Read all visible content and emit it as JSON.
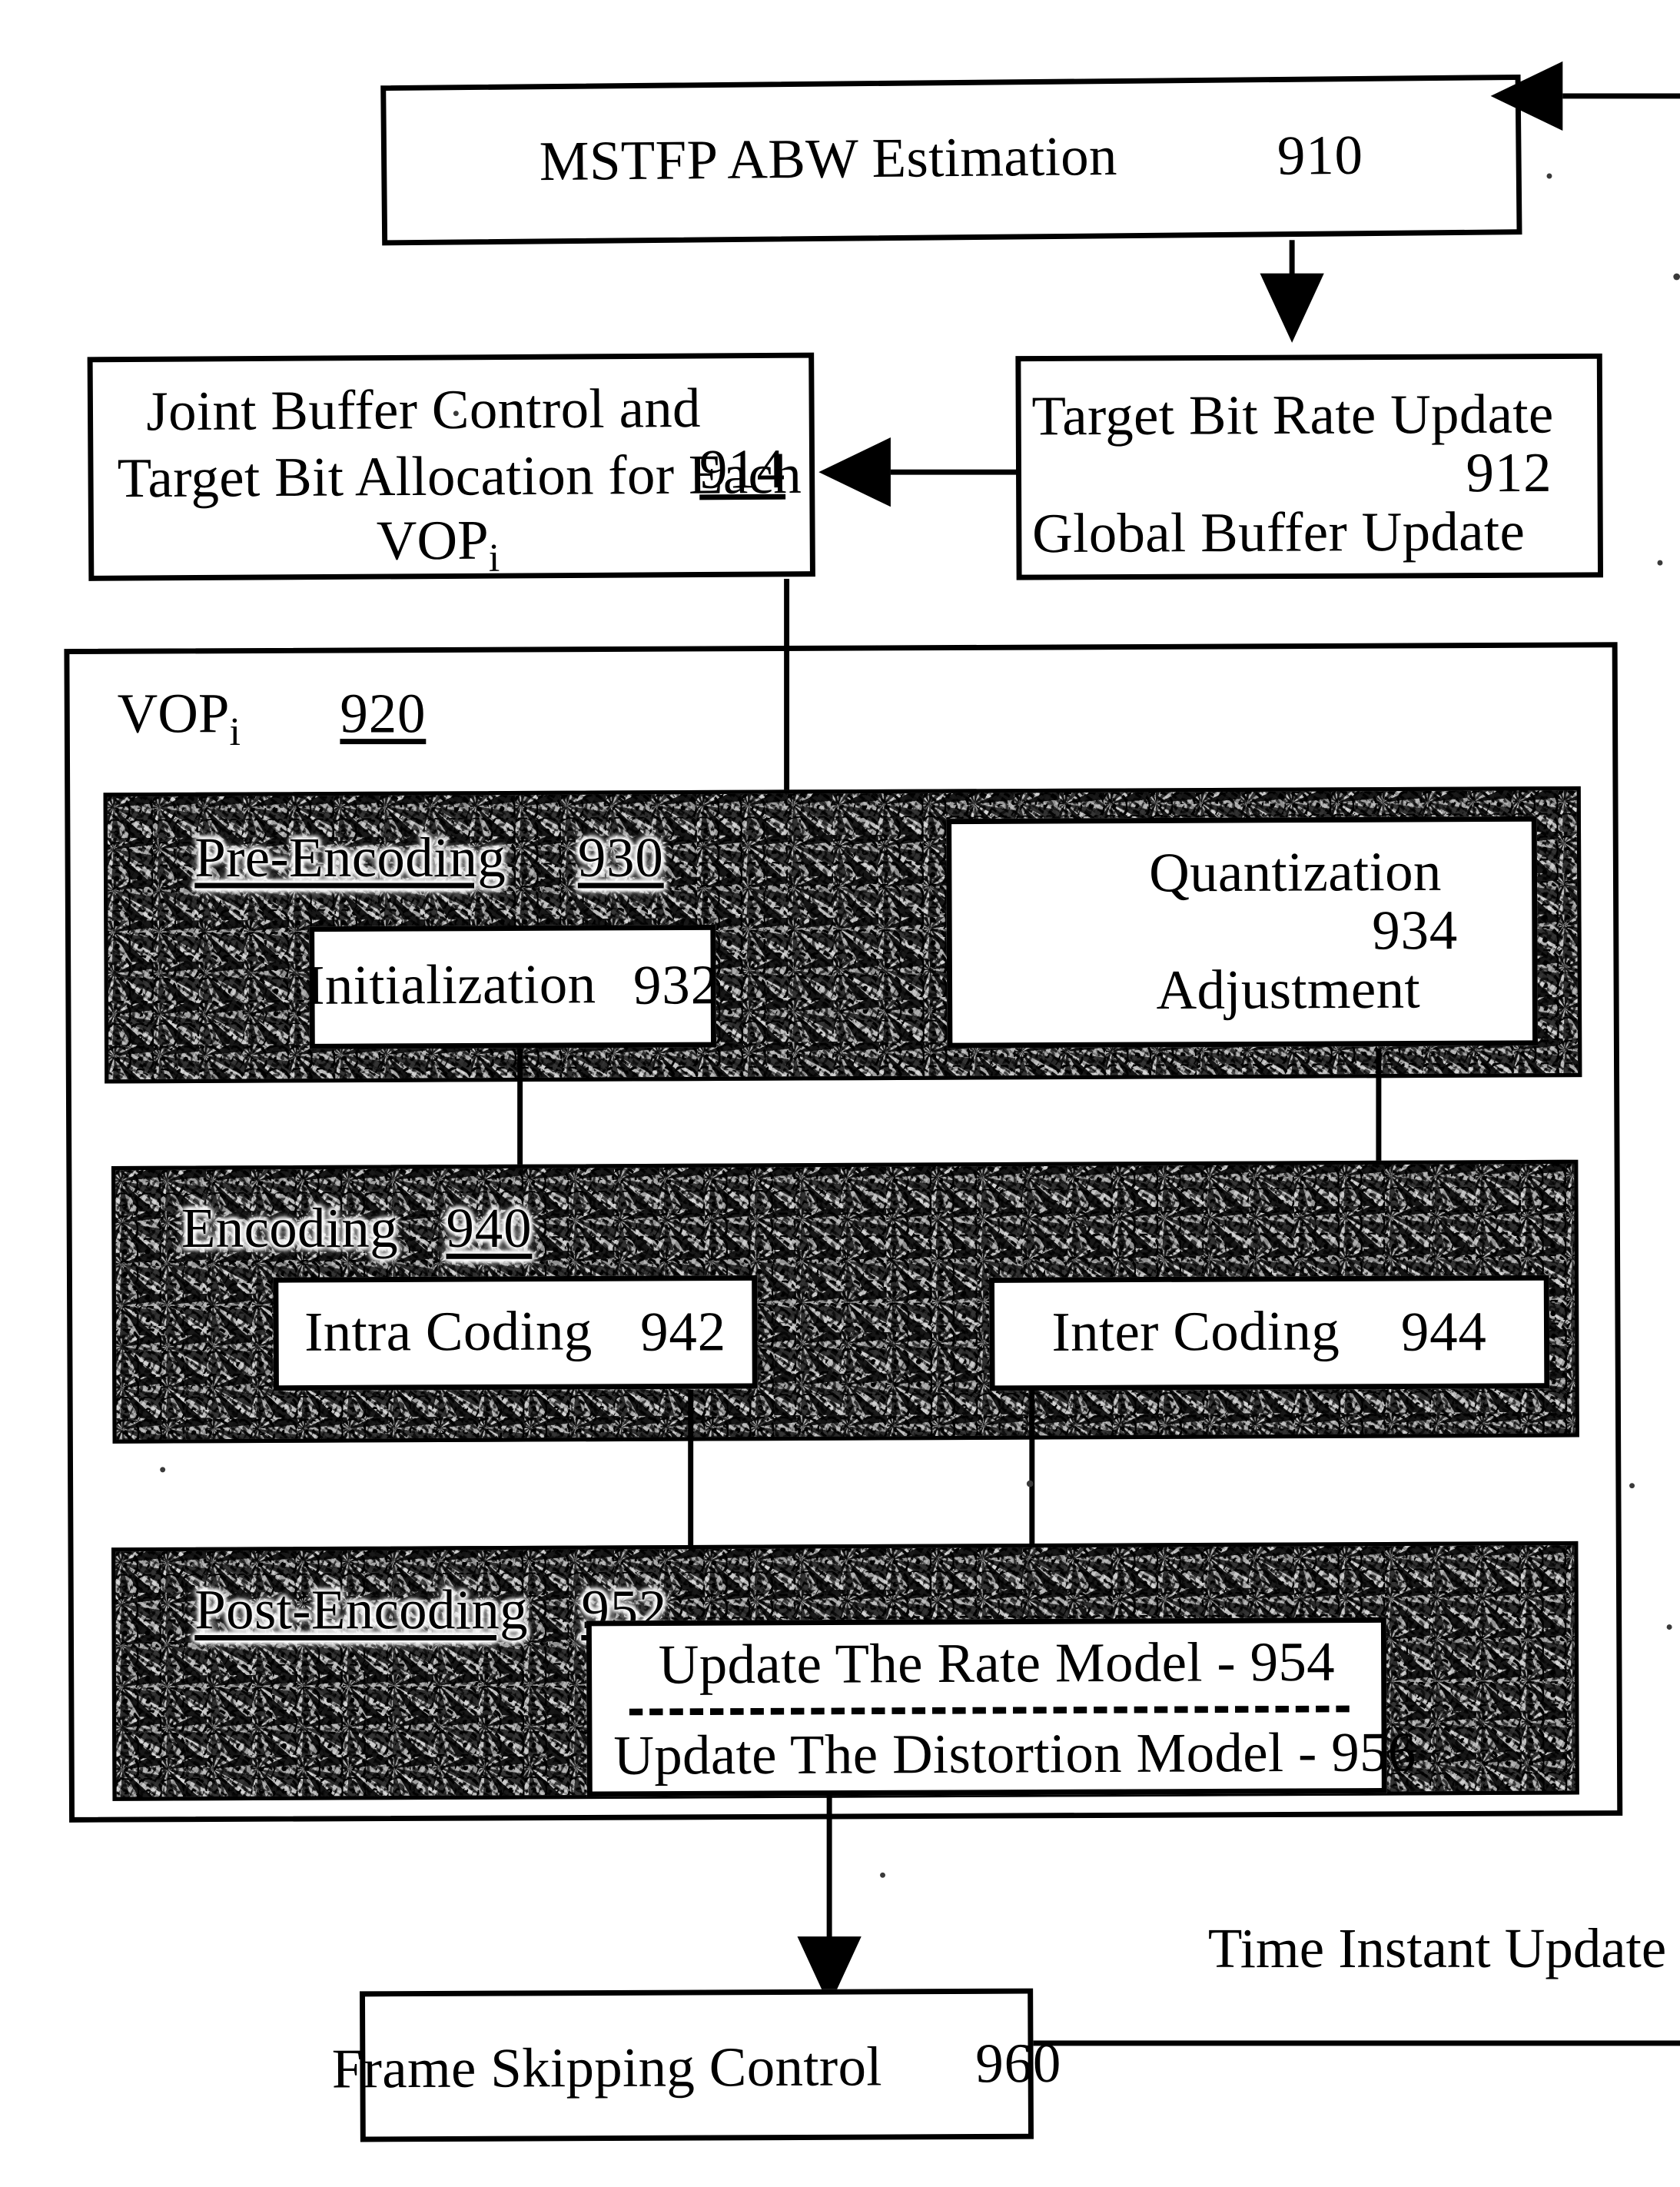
{
  "figure": {
    "type": "patent-flowchart",
    "boxes": {
      "b910": {
        "label": "MSTFP ABW Estimation",
        "ref": "910"
      },
      "b912": {
        "label_line1": "Target Bit Rate Update",
        "label_line2": "Global Buffer Update",
        "ref": "912"
      },
      "b914": {
        "label_line1": "Joint Buffer Control and",
        "label_line2": "Target Bit Allocation for Each",
        "label_line3": "VOP",
        "label_line3_sub": "i",
        "ref": "914"
      },
      "b920": {
        "label": "VOP",
        "label_sub": "i",
        "ref": "920"
      },
      "b930": {
        "label": "Pre-Encoding",
        "ref": "930"
      },
      "b932": {
        "label": "Initialization",
        "ref": "932"
      },
      "b934": {
        "label_line1": "Quantization",
        "label_line2": "Adjustment",
        "ref": "934"
      },
      "b940": {
        "label": "Encoding",
        "ref": "940"
      },
      "b942": {
        "label": "Intra Coding",
        "ref": "942"
      },
      "b944": {
        "label": "Inter Coding",
        "ref": "944"
      },
      "b952": {
        "label": "Post-Encoding",
        "ref": "952"
      },
      "b954": {
        "label": "Update The Rate Model - 954"
      },
      "b956": {
        "label": "Update The Distortion Model - 956"
      },
      "b960": {
        "label": "Frame Skipping Control",
        "ref": "960"
      }
    },
    "annotations": {
      "feedback_label": "Time Instant Update"
    },
    "colors": {
      "stroke": "#000000",
      "page": "#ffffff",
      "panel_fill": "#8a8a8a"
    }
  }
}
